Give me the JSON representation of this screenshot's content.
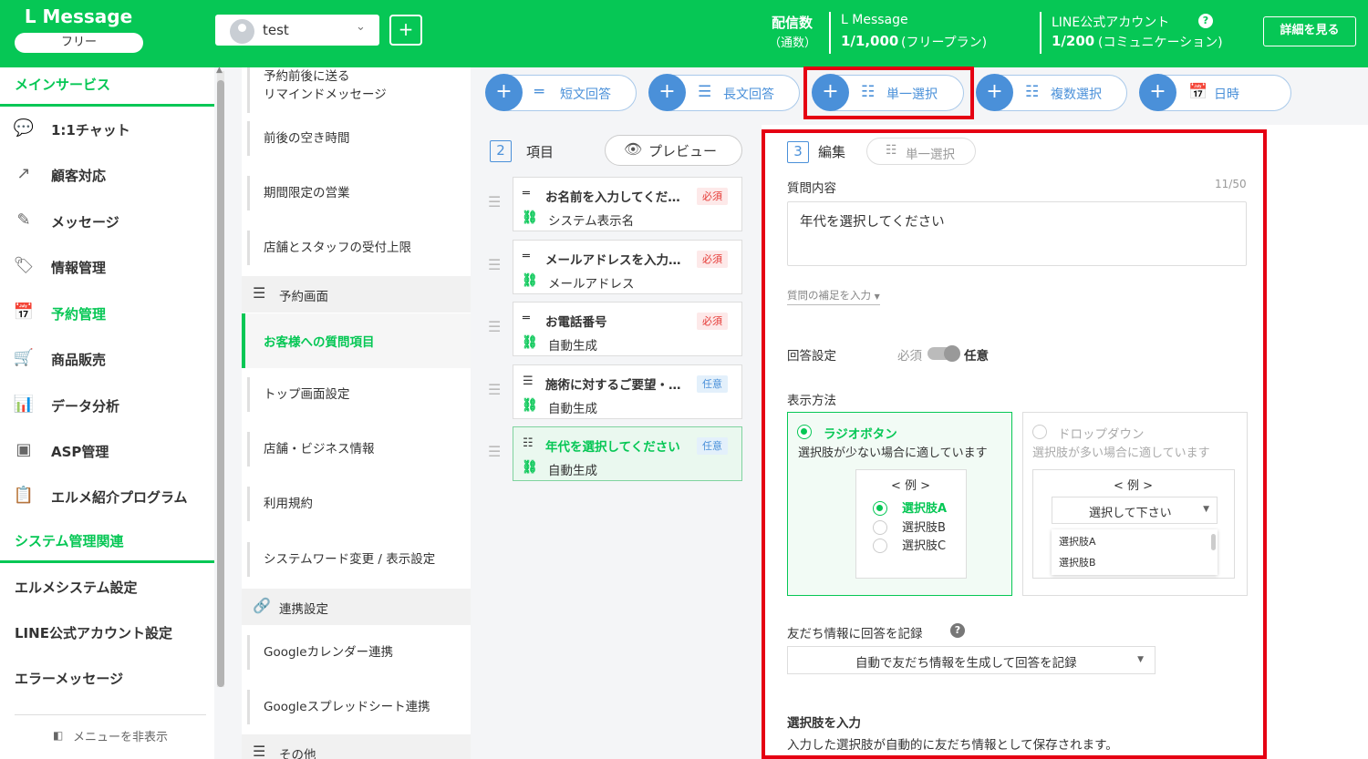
{
  "header": {
    "app_name": "L Message",
    "plan_badge": "フリー",
    "account_name": "test",
    "deliveries_label": "配信数",
    "deliveries_sub": "（通数）",
    "service_name": "L Message",
    "deliveries_value": "1/1,000",
    "deliveries_plan": "(フリープラン)",
    "line_label": "LINE公式アカウント",
    "line_value": "1/200",
    "line_plan": "(コミュニケーション)",
    "detail_button": "詳細を見る",
    "help_icon": "?"
  },
  "sidebar": {
    "section_main": "メインサービス",
    "items": [
      {
        "label": "1:1チャット",
        "icon": "chat-icon",
        "glyph": "💬"
      },
      {
        "label": "顧客対応",
        "icon": "external-link-icon",
        "glyph": "↗"
      },
      {
        "label": "メッセージ",
        "icon": "message-edit-icon",
        "glyph": "✎"
      },
      {
        "label": "情報管理",
        "icon": "tag-icon",
        "glyph": "🏷"
      },
      {
        "label": "予約管理",
        "icon": "calendar-icon",
        "glyph": "📅"
      },
      {
        "label": "商品販売",
        "icon": "cart-icon",
        "glyph": "🛒"
      },
      {
        "label": "データ分析",
        "icon": "chart-icon",
        "glyph": "📊"
      },
      {
        "label": "ASP管理",
        "icon": "asp-icon",
        "glyph": "▣"
      },
      {
        "label": "エルメ紹介プログラム",
        "icon": "clipboard-icon",
        "glyph": "📋"
      }
    ],
    "section_system": "システム管理関連",
    "system_items": [
      "エルメシステム設定",
      "LINE公式アカウント設定",
      "エラーメッセージ"
    ],
    "hide_menu": "メニューを非表示"
  },
  "submenu": {
    "items": [
      {
        "label": "予約前後に送る\nリマインドメッセージ"
      },
      {
        "label": "前後の空き時間"
      },
      {
        "label": "期間限定の営業"
      },
      {
        "label": "店舗とスタッフの受付上限"
      }
    ],
    "head_booking": "予約画面",
    "active": "お客様への質問項目",
    "items2": [
      "トップ画面設定",
      "店舗・ビジネス情報",
      "利用規約",
      "システムワード変更 / 表示設定"
    ],
    "head_link": "連携設定",
    "items3": [
      "Googleカレンダー連携",
      "Googleスプレッドシート連携"
    ],
    "head_other": "その他"
  },
  "types": [
    {
      "label": "短文回答",
      "icon": "short-text-icon",
      "glyph": "═"
    },
    {
      "label": "長文回答",
      "icon": "long-text-icon",
      "glyph": "☰"
    },
    {
      "label": "単一選択",
      "icon": "single-select-icon",
      "glyph": "☷"
    },
    {
      "label": "複数選択",
      "icon": "multi-select-icon",
      "glyph": "☷"
    },
    {
      "label": "日時",
      "icon": "calendar-icon",
      "glyph": "📅"
    }
  ],
  "items_col": {
    "num": "2",
    "title": "項目",
    "preview": "プレビュー",
    "cards": [
      {
        "title": "お名前を入力してくだ…",
        "badge": "必須",
        "link": "システム表示名",
        "type": "req",
        "glyph": "═"
      },
      {
        "title": "メールアドレスを入力…",
        "badge": "必須",
        "link": "メールアドレス",
        "type": "req",
        "glyph": "═"
      },
      {
        "title": "お電話番号",
        "badge": "必須",
        "link": "自動生成",
        "type": "req",
        "glyph": "═"
      },
      {
        "title": "施術に対するご要望・…",
        "badge": "任意",
        "link": "自動生成",
        "type": "opt",
        "glyph": "☰"
      },
      {
        "title": "年代を選択してください",
        "badge": "任意",
        "link": "自動生成",
        "type": "opt",
        "glyph": "☷"
      }
    ]
  },
  "edit": {
    "num": "3",
    "title": "編集",
    "type_pill": "単一選択",
    "question_label": "質問内容",
    "count": "11/50",
    "question_value": "年代を選択してください",
    "supplement": "質問の補足を入力",
    "answer_setting": "回答設定",
    "required": "必須",
    "optional": "任意",
    "display_label": "表示方法",
    "radio_title": "ラジオボタン",
    "radio_desc": "選択肢が少ない場合に適しています",
    "drop_title": "ドロップダウン",
    "drop_desc": "選択肢が多い場合に適しています",
    "example": "< 例 >",
    "opt_a": "選択肢A",
    "opt_b": "選択肢B",
    "opt_c": "選択肢C",
    "drop_placeholder": "選択して下さい",
    "record_label": "友だち情報に回答を記録",
    "record_value": "自動で友だち情報を生成して回答を記録",
    "choices_label": "選択肢を入力",
    "choices_desc": "入力した選択肢が自動的に友だち情報として保存されます。"
  },
  "colors": {
    "brand": "#06c755",
    "accent": "#4a90d9",
    "highlight": "#e50012"
  }
}
